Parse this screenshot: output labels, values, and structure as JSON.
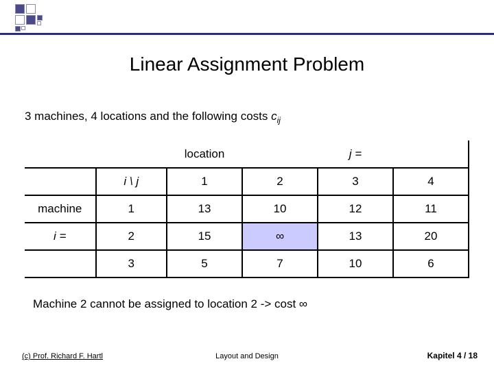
{
  "title": "Linear Assignment Problem",
  "subtitle_pre": "3 machines, 4 locations and the following costs ",
  "subtitle_c": "c",
  "subtitle_ij": "ij",
  "header": {
    "location": "location",
    "jeq": "j =",
    "ij": "i \\ j",
    "c1": "1",
    "c2": "2",
    "c3": "3",
    "c4": "4"
  },
  "rowlabels": {
    "machine": "machine",
    "ieq": "i ="
  },
  "rows": [
    {
      "i": "1",
      "v": [
        "13",
        "10",
        "12",
        "11"
      ]
    },
    {
      "i": "2",
      "v": [
        "15",
        "∞",
        "13",
        "20"
      ]
    },
    {
      "i": "3",
      "v": [
        "5",
        "7",
        "10",
        "6"
      ]
    }
  ],
  "note": "Machine 2 cannot be assigned to  location 2 -> cost ∞",
  "footer": {
    "left": "(c) Prof. Richard F. Hartl",
    "center": "Layout and Design",
    "right": "Kapitel 4 /  18"
  }
}
